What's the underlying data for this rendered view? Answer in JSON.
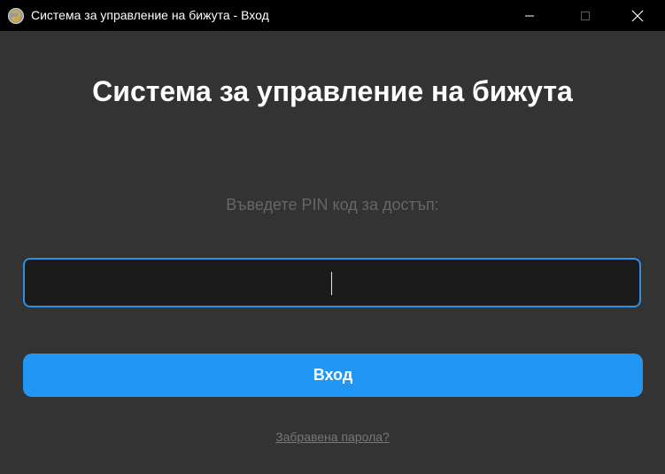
{
  "window": {
    "title": "Система за управление на бижута - Вход",
    "icon": "app-logo-icon",
    "controls": [
      "minimize-icon",
      "maximize-icon",
      "close-icon"
    ]
  },
  "login": {
    "heading": "Система за управление на бижута",
    "pin_label": "Въведете PIN код за достъп:",
    "pin_value": "",
    "submit_label": "Вход",
    "forgot_label": "Забравена парола?"
  },
  "colors": {
    "background": "#333333",
    "titlebar": "#000000",
    "accent": "#2196f3",
    "input_border": "#2e8fe3",
    "input_bg": "#1b1b1b",
    "muted_text": "#666666"
  }
}
